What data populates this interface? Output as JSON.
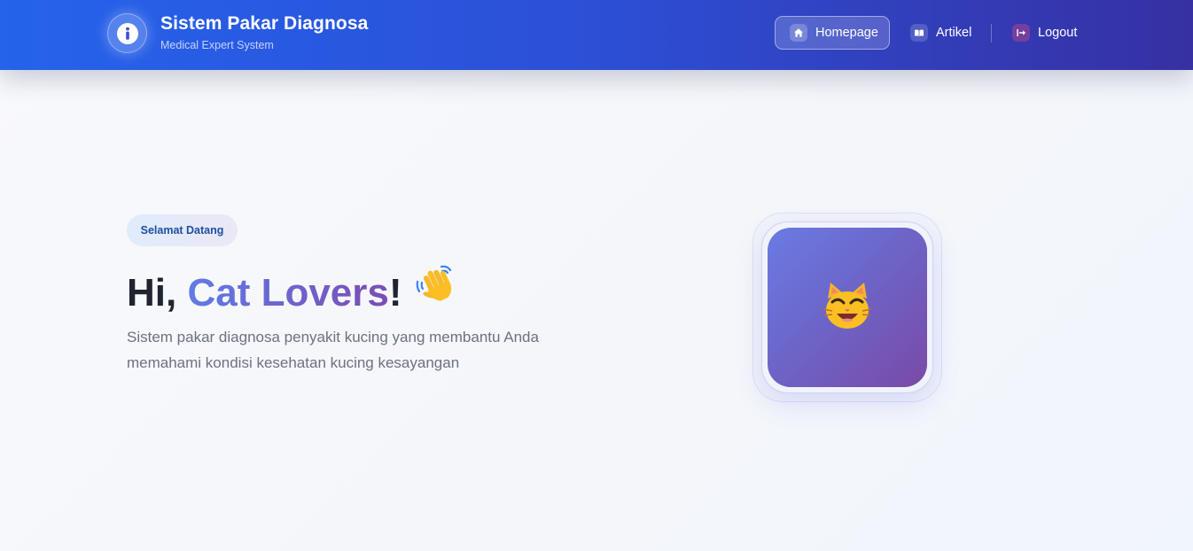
{
  "header": {
    "brand_title": "Sistem Pakar Diagnosa",
    "brand_subtitle": "Medical Expert System",
    "nav": {
      "homepage": "Homepage",
      "artikel": "Artikel",
      "logout": "Logout"
    }
  },
  "hero": {
    "badge": "Selamat Datang",
    "title_prefix": "Hi, ",
    "title_highlight": "Cat Lovers",
    "title_suffix": "!",
    "description": "Sistem pakar diagnosa penyakit kucing yang membantu Anda memahami kondisi kesehatan kucing kesayangan"
  },
  "icons": {
    "brand": "info-icon",
    "homepage": "home-icon",
    "artikel": "book-icon",
    "logout": "logout-icon",
    "greeting": "waving-hand-icon",
    "cat": "cat-face-icon"
  },
  "colors": {
    "navbar_start": "#2563eb",
    "navbar_end": "#3730a3",
    "highlight_start": "#5f7be6",
    "highlight_end": "#7b4db3",
    "card_start": "#6a7be3",
    "card_end": "#7a4aa6",
    "badge_text": "#1e4fa3"
  }
}
